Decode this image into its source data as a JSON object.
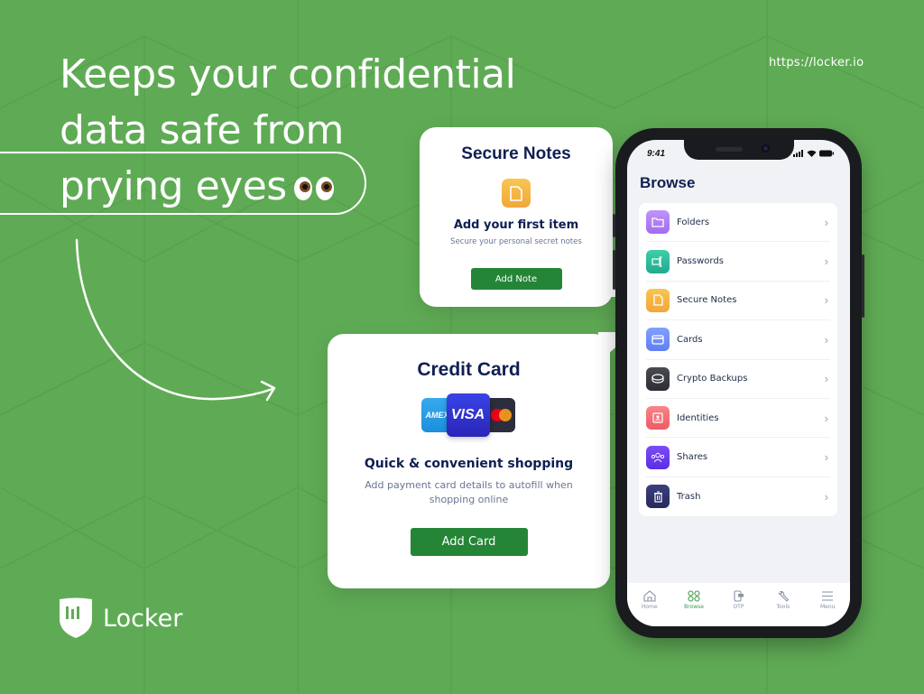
{
  "headline": {
    "lines": [
      "Keeps your confidential",
      "data safe from",
      "prying eyes"
    ],
    "emoji": "eyes-emoji"
  },
  "url": "https://locker.io",
  "brand": {
    "name": "Locker",
    "colors": {
      "background": "#5fab55",
      "button": "#248536",
      "title": "#0e1f52"
    }
  },
  "secure_notes_card": {
    "title": "Secure Notes",
    "icon": "note-icon",
    "subtitle": "Add your first item",
    "description": "Secure your personal secret notes",
    "button_label": "Add Note"
  },
  "credit_card_card": {
    "title": "Credit Card",
    "card_brands": [
      "AMEX",
      "VISA",
      "Mastercard"
    ],
    "amex_label": "AMEX",
    "visa_label": "VISA",
    "subtitle": "Quick & convenient shopping",
    "description": "Add payment card details to autofill when shopping online",
    "button_label": "Add Card"
  },
  "phone": {
    "status_time": "9:41",
    "screen_title": "Browse",
    "items": [
      {
        "label": "Folders",
        "icon": "folder-icon",
        "color": "#b07cf5"
      },
      {
        "label": "Passwords",
        "icon": "password-icon",
        "color": "#2fbf9e"
      },
      {
        "label": "Secure Notes",
        "icon": "note-icon",
        "color": "#f5b448"
      },
      {
        "label": "Cards",
        "icon": "card-icon",
        "color": "#6f8df5"
      },
      {
        "label": "Crypto Backups",
        "icon": "crypto-icon",
        "color": "#3a3b40"
      },
      {
        "label": "Identities",
        "icon": "identity-icon",
        "color": "#f26f73"
      },
      {
        "label": "Shares",
        "icon": "shares-icon",
        "color": "#6b3df0"
      },
      {
        "label": "Trash",
        "icon": "trash-icon",
        "color": "#33366e"
      }
    ],
    "tabs": [
      {
        "label": "Home",
        "icon": "home-icon",
        "active": false
      },
      {
        "label": "Browse",
        "icon": "grid-icon",
        "active": true
      },
      {
        "label": "OTP",
        "icon": "otp-icon",
        "active": false
      },
      {
        "label": "Tools",
        "icon": "wrench-icon",
        "active": false
      },
      {
        "label": "Menu",
        "icon": "menu-icon",
        "active": false
      }
    ]
  }
}
